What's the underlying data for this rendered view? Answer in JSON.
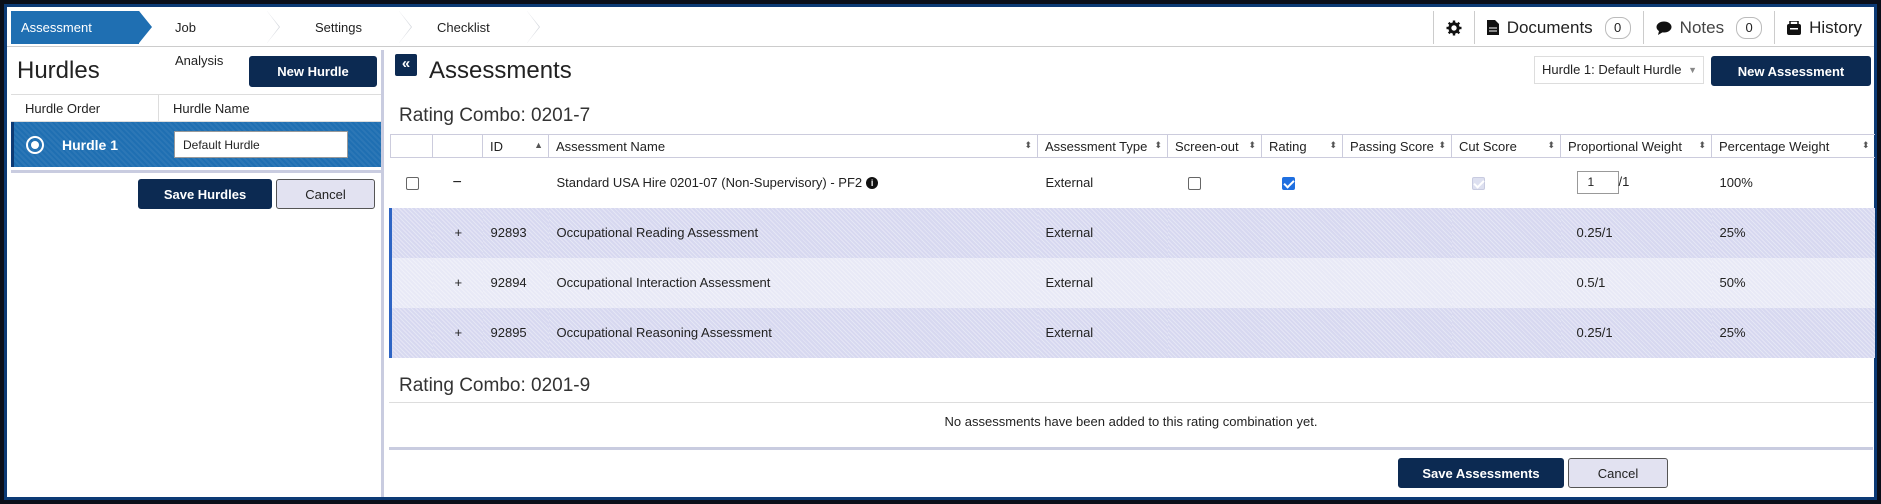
{
  "nav": {
    "steps": [
      "Assessment Plan",
      "Job Analysis",
      "Settings",
      "Checklist"
    ],
    "settings_icon": "gear-icon",
    "documents_label": "Documents",
    "documents_count": "0",
    "notes_label": "Notes",
    "notes_count": "0",
    "history_label": "History"
  },
  "hurdles": {
    "title": "Hurdles",
    "new_button": "New Hurdle",
    "col_order": "Hurdle Order",
    "col_name": "Hurdle Name",
    "row": {
      "order": "Hurdle 1",
      "name": "Default Hurdle"
    },
    "save_button": "Save Hurdles",
    "cancel_button": "Cancel"
  },
  "assessments": {
    "title": "Assessments",
    "collapse_icon": "«",
    "hurdle_select": "Hurdle 1: Default Hurdle",
    "new_button": "New Assessment",
    "combo1_title": "Rating Combo: 0201-7",
    "combo2_title": "Rating Combo: 0201-9",
    "columns": [
      "ID",
      "Assessment Name",
      "Assessment Type",
      "Screen-out",
      "Rating",
      "Passing Score",
      "Cut Score",
      "Proportional Weight",
      "Percentage Weight"
    ],
    "main_row": {
      "name": "Standard USA Hire 0201-07 (Non-Supervisory) - PF2",
      "type": "External",
      "screen_out": false,
      "rating": true,
      "cut_score": true,
      "weight_value": "1",
      "weight_suffix": "/1",
      "percentage": "100%",
      "toggle": "−"
    },
    "sub_rows": [
      {
        "toggle": "+",
        "id": "92893",
        "name": "Occupational Reading Assessment",
        "type": "External",
        "weight": "0.25/1",
        "percentage": "25%"
      },
      {
        "toggle": "+",
        "id": "92894",
        "name": "Occupational Interaction Assessment",
        "type": "External",
        "weight": "0.5/1",
        "percentage": "50%"
      },
      {
        "toggle": "+",
        "id": "92895",
        "name": "Occupational Reasoning Assessment",
        "type": "External",
        "weight": "0.25/1",
        "percentage": "25%"
      }
    ],
    "empty_message": "No assessments have been added to this rating combination yet.",
    "save_button": "Save Assessments",
    "cancel_button": "Cancel"
  },
  "colors": {
    "accent": "#1f6fb2",
    "dark_button": "#0c2a52",
    "row_highlight": "#d7d8f0"
  }
}
